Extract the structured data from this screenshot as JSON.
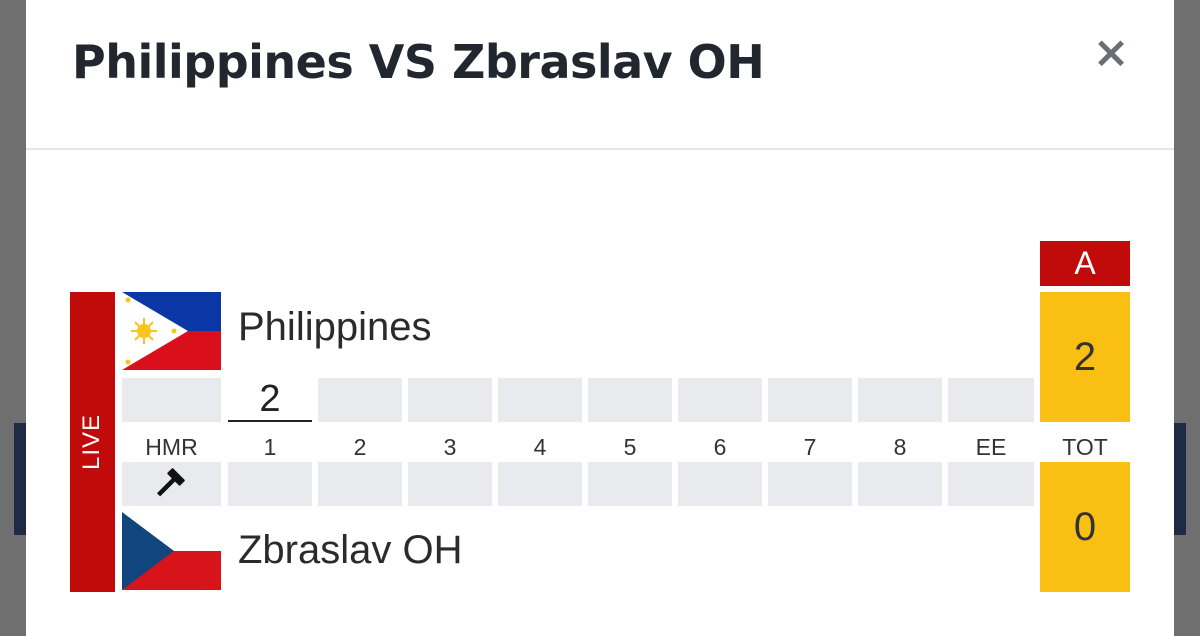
{
  "modal": {
    "title": "Philippines VS Zbraslav OH",
    "close_label": "×"
  },
  "scoreboard": {
    "live_label": "LIVE",
    "set_label": "A",
    "columns": [
      "HMR",
      "1",
      "2",
      "3",
      "4",
      "5",
      "6",
      "7",
      "8",
      "EE",
      "TOT"
    ],
    "hammer_icon": "hammer-icon",
    "team_top": {
      "name": "Philippines",
      "flag_icon": "philippines-flag-icon",
      "ends": [
        "2",
        "",
        "",
        "",
        "",
        "",
        "",
        "",
        ""
      ],
      "total": "2"
    },
    "team_bottom": {
      "name": "Zbraslav OH",
      "flag_icon": "czech-flag-icon",
      "ends": [
        "",
        "",
        "",
        "",
        "",
        "",
        "",
        "",
        ""
      ],
      "total": "0"
    }
  },
  "colors": {
    "live_red": "#c10a0a",
    "total_yellow": "#f9c013",
    "cell_gray": "#e8eaed"
  }
}
